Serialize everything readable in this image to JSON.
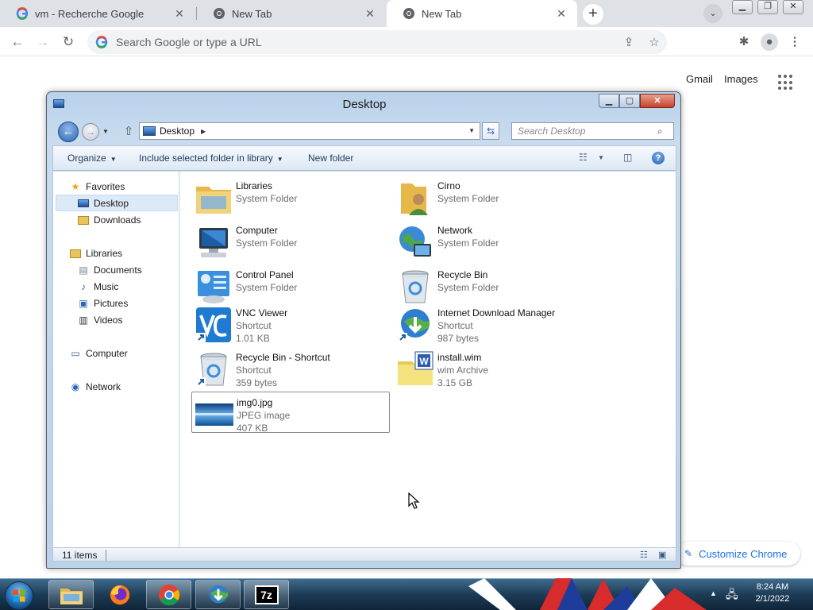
{
  "browser": {
    "tabs": [
      {
        "title": "vm - Recherche Google",
        "active": false
      },
      {
        "title": "New Tab",
        "active": false
      },
      {
        "title": "New Tab",
        "active": true
      }
    ],
    "omnibox_placeholder": "Search Google or type a URL",
    "google_links": {
      "gmail": "Gmail",
      "images": "Images"
    },
    "customize": "Customize Chrome"
  },
  "explorer": {
    "title": "Desktop",
    "address": "Desktop",
    "search_placeholder": "Search Desktop",
    "commands": {
      "organize": "Organize",
      "include": "Include selected folder in library",
      "new_folder": "New folder"
    },
    "nav": {
      "favorites": "Favorites",
      "desktop": "Desktop",
      "downloads": "Downloads",
      "libraries": "Libraries",
      "documents": "Documents",
      "music": "Music",
      "pictures": "Pictures",
      "videos": "Videos",
      "computer": "Computer",
      "network": "Network"
    },
    "items": [
      {
        "name": "Libraries",
        "type": "System Folder",
        "size": ""
      },
      {
        "name": "Cirno",
        "type": "System Folder",
        "size": ""
      },
      {
        "name": "Computer",
        "type": "System Folder",
        "size": ""
      },
      {
        "name": "Network",
        "type": "System Folder",
        "size": ""
      },
      {
        "name": "Control Panel",
        "type": "System Folder",
        "size": ""
      },
      {
        "name": "Recycle Bin",
        "type": "System Folder",
        "size": ""
      },
      {
        "name": "VNC Viewer",
        "type": "Shortcut",
        "size": "1.01 KB"
      },
      {
        "name": "Internet Download Manager",
        "type": "Shortcut",
        "size": "987 bytes"
      },
      {
        "name": "Recycle Bin - Shortcut",
        "type": "Shortcut",
        "size": "359 bytes"
      },
      {
        "name": "install.wim",
        "type": "wim Archive",
        "size": "3.15 GB"
      },
      {
        "name": "img0.jpg",
        "type": "JPEG image",
        "size": "407 KB"
      }
    ],
    "status": "11 items"
  },
  "taskbar": {
    "time": "8:24 AM",
    "date": "2/1/2022",
    "apps": [
      "explorer-icon",
      "firefox-icon",
      "chrome-icon",
      "idm-icon",
      "7zip-icon"
    ],
    "sevenzip_label": "7z"
  }
}
